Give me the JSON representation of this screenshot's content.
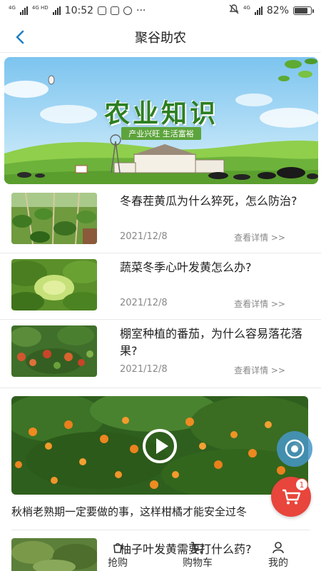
{
  "status_bar": {
    "network_left": "4G",
    "network_left_2": "4G HD",
    "time": "10:52",
    "more": "···",
    "network_right": "4G",
    "battery": "82%",
    "battery_level": 0.82
  },
  "nav": {
    "back_icon": "chevron-left-icon",
    "title": "聚谷助农"
  },
  "banner": {
    "title": "农业知识",
    "subtitle": "产业兴旺 生活富裕"
  },
  "articles": [
    {
      "title": "冬春茬黄瓜为什么猝死，怎么防治?",
      "date": "2021/12/8",
      "more": "查看详情 >>"
    },
    {
      "title": "蔬菜冬季心叶发黄怎么办?",
      "date": "2021/12/8",
      "more": "查看详情 >>"
    },
    {
      "title": "棚室种植的番茄，为什么容易落花落果?",
      "date": "2021/12/8",
      "more": "查看详情 >>"
    }
  ],
  "video": {
    "caption": "秋梢老熟期一定要做的事，这样柑橘才能安全过冬",
    "play_icon": "play-icon"
  },
  "partial_article": {
    "title": "柚子叶发黄需要打什么药?"
  },
  "tabbar": {
    "items": [
      {
        "label": "抢购",
        "icon": "flash-sale-icon"
      },
      {
        "label": "购物车",
        "icon": "cart-icon"
      },
      {
        "label": "我的",
        "icon": "user-icon"
      }
    ]
  },
  "cart_float": {
    "badge": "1"
  },
  "colors": {
    "accent_blue": "#1f7fc4",
    "banner_green": "#2d7f22",
    "cart_red": "#e8453c"
  }
}
